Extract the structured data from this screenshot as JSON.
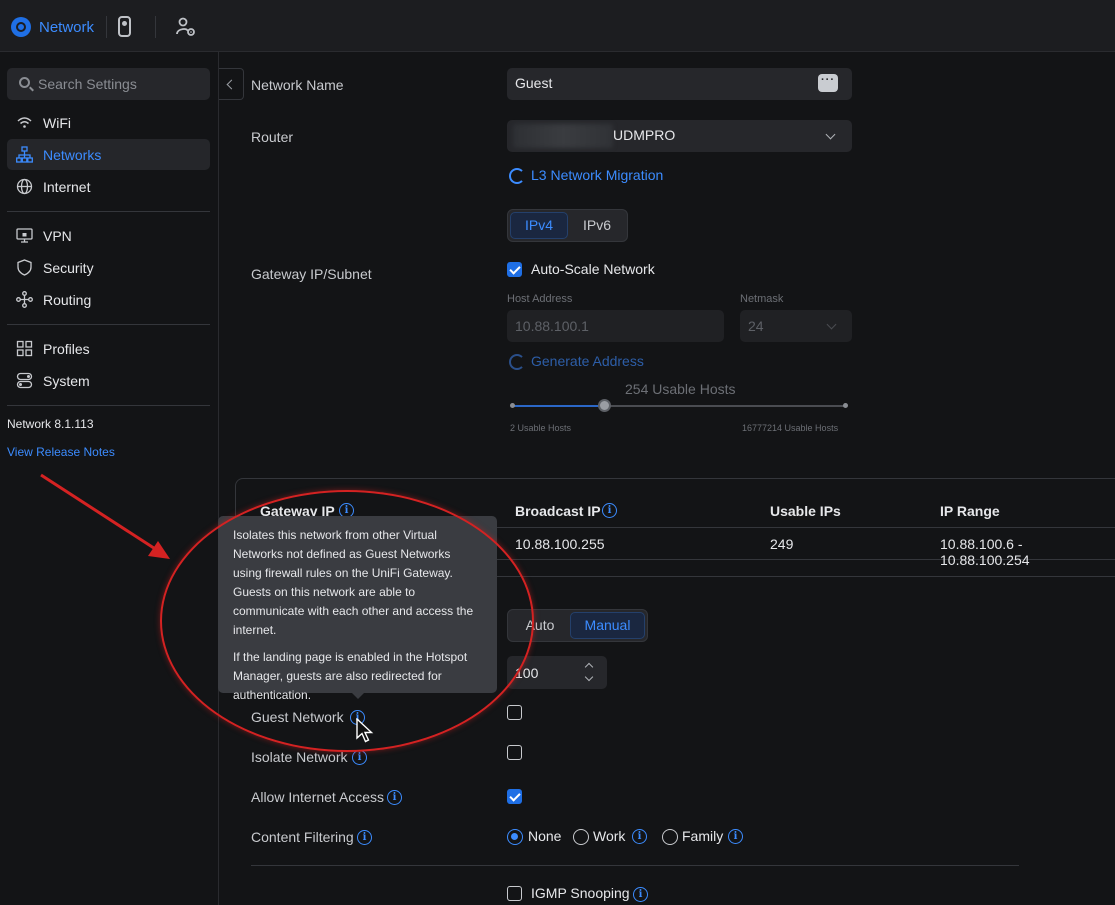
{
  "topbar": {
    "app_name": "Network"
  },
  "sidebar": {
    "search_placeholder": "Search Settings",
    "items": [
      {
        "label": "WiFi",
        "icon": "wifi-icon"
      },
      {
        "label": "Networks",
        "icon": "network-topology-icon",
        "active": true
      },
      {
        "label": "Internet",
        "icon": "globe-icon"
      },
      {
        "label": "VPN",
        "icon": "vpn-icon"
      },
      {
        "label": "Security",
        "icon": "shield-icon"
      },
      {
        "label": "Routing",
        "icon": "routing-icon"
      },
      {
        "label": "Profiles",
        "icon": "profiles-icon"
      },
      {
        "label": "System",
        "icon": "toggles-icon"
      }
    ],
    "version": "Network 8.1.113",
    "release_notes": "View Release Notes"
  },
  "form": {
    "network_name_label": "Network Name",
    "network_name_value": "Guest",
    "router_label": "Router",
    "router_value": "UDMPRO",
    "l3_migration": "L3 Network Migration",
    "ip_tabs": [
      "IPv4",
      "IPv6"
    ],
    "gateway_label": "Gateway IP/Subnet",
    "auto_scale_label": "Auto-Scale Network",
    "host_address_label": "Host Address",
    "host_address_value": "10.88.100.1",
    "netmask_label": "Netmask",
    "netmask_value": "24",
    "generate_address": "Generate Address",
    "usable_hosts": "254 Usable Hosts",
    "slider_min_label": "2 Usable Hosts",
    "slider_max_label": "16777214 Usable Hosts",
    "mode_tabs": [
      "Auto",
      "Manual"
    ],
    "vlan_value": "100",
    "guest_network_label": "Guest Network",
    "isolate_network_label": "Isolate Network",
    "allow_internet_label": "Allow Internet Access",
    "content_filtering_label": "Content Filtering",
    "filter_options": [
      "None",
      "Work",
      "Family"
    ],
    "igmp_label": "IGMP Snooping"
  },
  "ip_table": {
    "headers": [
      "Gateway IP",
      "Broadcast IP",
      "Usable IPs",
      "IP Range"
    ],
    "row": [
      "",
      "10.88.100.255",
      "249",
      "10.88.100.6 - 10.88.100.254"
    ]
  },
  "tooltip": {
    "p1": "Isolates this network from other Virtual Networks not defined as Guest Networks using firewall rules on the UniFi Gateway. Guests on this network are able to communicate with each other and access the internet.",
    "p2": "If the landing page is enabled in the Hotspot Manager, guests are also redirected for authentication."
  },
  "colors": {
    "accent": "#3c8cff",
    "annotation": "#d42222",
    "background": "#131416"
  }
}
